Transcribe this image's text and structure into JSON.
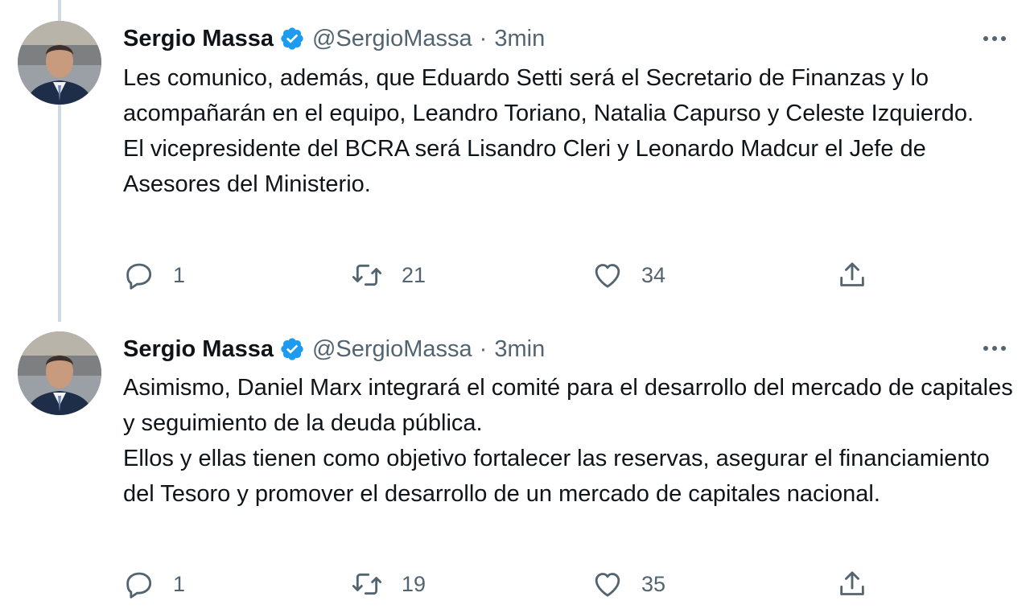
{
  "tweets": [
    {
      "author": {
        "name": "Sergio Massa",
        "handle": "@SergioMassa",
        "verified": true,
        "avatar_icon": "profile-photo"
      },
      "separator": "·",
      "time": "3min",
      "body": {
        "lines": [
          "Les comunico, además, que Eduardo Setti será el Secretario de Finanzas y lo acompañarán en el equipo, Leandro Toriano, Natalia Capurso y Celeste Izquierdo.",
          "El vicepresidente del BCRA será Lisandro Cleri y Leonardo Madcur el Jefe de Asesores del Ministerio."
        ]
      },
      "actions": {
        "reply_count": "1",
        "retweet_count": "21",
        "like_count": "34",
        "share_icon": "share-icon"
      }
    },
    {
      "author": {
        "name": "Sergio Massa",
        "handle": "@SergioMassa",
        "verified": true,
        "avatar_icon": "profile-photo"
      },
      "separator": "·",
      "time": "3min",
      "body": {
        "lines": [
          "Asimismo, Daniel Marx integrará el comité para el desarrollo del mercado de capitales y seguimiento de la deuda pública.",
          "Ellos y ellas tienen como objetivo fortalecer las reservas, asegurar el financiamiento del Tesoro y promover el desarrollo de un mercado de capitales nacional."
        ]
      },
      "actions": {
        "reply_count": "1",
        "retweet_count": "19",
        "like_count": "35",
        "share_icon": "share-icon"
      }
    }
  ],
  "colors": {
    "verified_badge": "#1d9bf0",
    "secondary_text": "#536471",
    "primary_text": "#0f1419",
    "thread_line": "#cfd9de"
  }
}
